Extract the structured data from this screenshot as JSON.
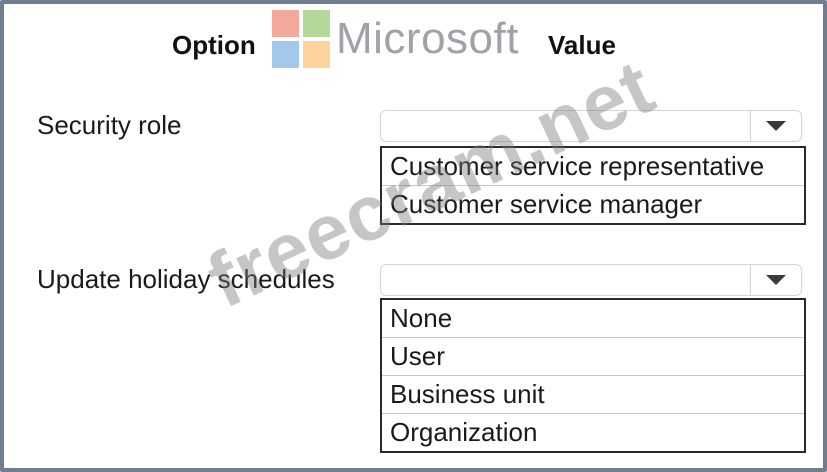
{
  "header": {
    "option_label": "Option",
    "value_label": "Value",
    "brand": "Microsoft"
  },
  "security_role": {
    "label": "Security role",
    "selected": "",
    "options": [
      "Customer service representative",
      "Customer service manager"
    ]
  },
  "holiday_schedules": {
    "label": "Update holiday schedules",
    "selected": "",
    "options": [
      "None",
      "User",
      "Business unit",
      "Organization"
    ]
  },
  "watermark": "freecram.net",
  "icons": {
    "logo": "microsoft-logo-icon",
    "dropdown": "chevron-down-icon"
  }
}
